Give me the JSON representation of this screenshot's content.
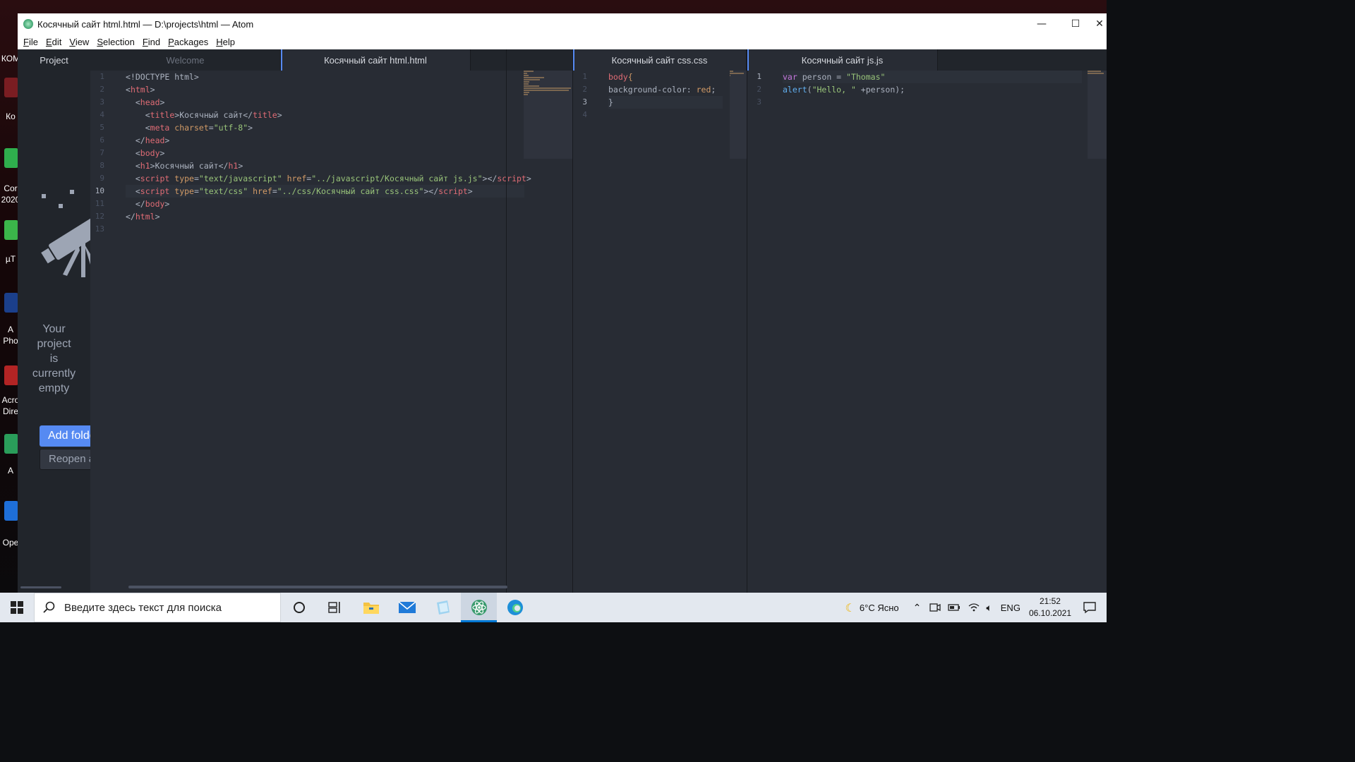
{
  "window": {
    "title": "Косячный сайт html.html — D:\\projects\\html — Atom",
    "controls": {
      "minimize": "—",
      "maximize": "☐",
      "close": "✕"
    }
  },
  "menu": [
    "File",
    "Edit",
    "View",
    "Selection",
    "Find",
    "Packages",
    "Help"
  ],
  "tree_view": {
    "tab_label": "Project",
    "empty_message": [
      "Your",
      "project",
      "is",
      "currently",
      "empty"
    ],
    "add_folder_label": "Add folders",
    "reopen_label": "Reopen a project"
  },
  "panes": [
    {
      "tabs": [
        {
          "label": "Welcome",
          "active": false
        },
        {
          "label": "Косячный сайт html.html",
          "active": true
        }
      ],
      "line_numbers": [
        "1",
        "2",
        "3",
        "4",
        "5",
        "6",
        "7",
        "8",
        "9",
        "10",
        "11",
        "12",
        "13"
      ],
      "current_line": 10
    },
    {
      "tabs": [
        {
          "label": "Косячный сайт css.css",
          "active": true
        }
      ],
      "line_numbers": [
        "1",
        "2",
        "3",
        "4"
      ],
      "current_line": 3
    },
    {
      "tabs": [
        {
          "label": "Косячный сайт js.js",
          "active": true
        }
      ],
      "line_numbers": [
        "1",
        "2",
        "3"
      ],
      "current_line": 1
    }
  ],
  "html_code": [
    [
      [
        "t-punc",
        "<!DOCTYPE html>"
      ]
    ],
    [
      [
        "t-punc",
        "<"
      ],
      [
        "t-tag",
        "html"
      ],
      [
        "t-punc",
        ">"
      ]
    ],
    [
      [
        "t-pl",
        "  "
      ],
      [
        "t-punc",
        "<"
      ],
      [
        "t-tag",
        "head"
      ],
      [
        "t-punc",
        ">"
      ]
    ],
    [
      [
        "t-pl",
        "    "
      ],
      [
        "t-punc",
        "<"
      ],
      [
        "t-tag",
        "title"
      ],
      [
        "t-punc",
        ">"
      ],
      [
        "t-pl",
        "Косячный сайт"
      ],
      [
        "t-punc",
        "</"
      ],
      [
        "t-tag",
        "title"
      ],
      [
        "t-punc",
        ">"
      ]
    ],
    [
      [
        "t-pl",
        "    "
      ],
      [
        "t-punc",
        "<"
      ],
      [
        "t-tag",
        "meta"
      ],
      [
        "t-pl",
        " "
      ],
      [
        "t-attr",
        "charset"
      ],
      [
        "t-punc",
        "="
      ],
      [
        "t-str",
        "\"utf-8\""
      ],
      [
        "t-punc",
        ">"
      ]
    ],
    [
      [
        "t-pl",
        "  "
      ],
      [
        "t-punc",
        "</"
      ],
      [
        "t-tag",
        "head"
      ],
      [
        "t-punc",
        ">"
      ]
    ],
    [
      [
        "t-pl",
        "  "
      ],
      [
        "t-punc",
        "<"
      ],
      [
        "t-tag",
        "body"
      ],
      [
        "t-punc",
        ">"
      ]
    ],
    [
      [
        "t-pl",
        "  "
      ],
      [
        "t-punc",
        "<"
      ],
      [
        "t-tag",
        "h1"
      ],
      [
        "t-punc",
        ">"
      ],
      [
        "t-pl",
        "Косячный сайт"
      ],
      [
        "t-punc",
        "</"
      ],
      [
        "t-tag",
        "h1"
      ],
      [
        "t-punc",
        ">"
      ]
    ],
    [
      [
        "t-pl",
        "  "
      ],
      [
        "t-punc",
        "<"
      ],
      [
        "t-tag",
        "script"
      ],
      [
        "t-pl",
        " "
      ],
      [
        "t-attr",
        "type"
      ],
      [
        "t-punc",
        "="
      ],
      [
        "t-str",
        "\"text/javascript\""
      ],
      [
        "t-pl",
        " "
      ],
      [
        "t-attr",
        "href"
      ],
      [
        "t-punc",
        "="
      ],
      [
        "t-str",
        "\"../javascript/Косячный сайт js.js\""
      ],
      [
        "t-punc",
        "></"
      ],
      [
        "t-tag",
        "script"
      ],
      [
        "t-punc",
        ">"
      ]
    ],
    [
      [
        "t-pl",
        "  "
      ],
      [
        "t-punc",
        "<"
      ],
      [
        "t-tag",
        "script"
      ],
      [
        "t-pl",
        " "
      ],
      [
        "t-attr",
        "type"
      ],
      [
        "t-punc",
        "="
      ],
      [
        "t-str",
        "\"text/css\""
      ],
      [
        "t-pl",
        " "
      ],
      [
        "t-attr",
        "href"
      ],
      [
        "t-punc",
        "="
      ],
      [
        "t-str",
        "\"../css/Косячный сайт css.css\""
      ],
      [
        "t-punc",
        "></"
      ],
      [
        "t-tag",
        "script"
      ],
      [
        "t-punc",
        ">"
      ]
    ],
    [
      [
        "t-pl",
        "  "
      ],
      [
        "t-punc",
        "</"
      ],
      [
        "t-tag",
        "body"
      ],
      [
        "t-punc",
        ">"
      ]
    ],
    [
      [
        "t-punc",
        "</"
      ],
      [
        "t-tag",
        "html"
      ],
      [
        "t-punc",
        ">"
      ]
    ],
    []
  ],
  "css_code": [
    [
      [
        "t-tag",
        "body"
      ],
      [
        "t-attr",
        "{"
      ]
    ],
    [
      [
        "t-pl",
        "background-color: "
      ],
      [
        "t-attr",
        "red"
      ],
      [
        "t-pl",
        ";"
      ]
    ],
    [
      [
        "t-brk",
        "}"
      ]
    ],
    []
  ],
  "js_code": [
    [
      [
        "t-kw",
        "var"
      ],
      [
        "t-pl",
        " person = "
      ],
      [
        "t-str",
        "\"Thomas\""
      ]
    ],
    [
      [
        "t-fn",
        "alert"
      ],
      [
        "t-pl",
        "("
      ],
      [
        "t-str",
        "\"Hello, \""
      ],
      [
        "t-pl",
        " +person);"
      ]
    ],
    []
  ],
  "taskbar": {
    "search_placeholder": "Введите здесь текст для поиска",
    "weather": "6°C  Ясно",
    "language": "ENG",
    "time": "21:52",
    "date": "06.10.2021"
  },
  "desktop_labels": [
    "КОМ",
    "Ко",
    "Cor",
    "2020",
    "µT",
    "A",
    "Pho",
    "Acro",
    "Dire",
    "A",
    "Ope"
  ],
  "colors": {
    "accent": "#568af2",
    "tag": "#e06c75",
    "string": "#98c379",
    "attribute": "#d19a66",
    "keyword": "#c678dd",
    "function": "#61afef"
  }
}
